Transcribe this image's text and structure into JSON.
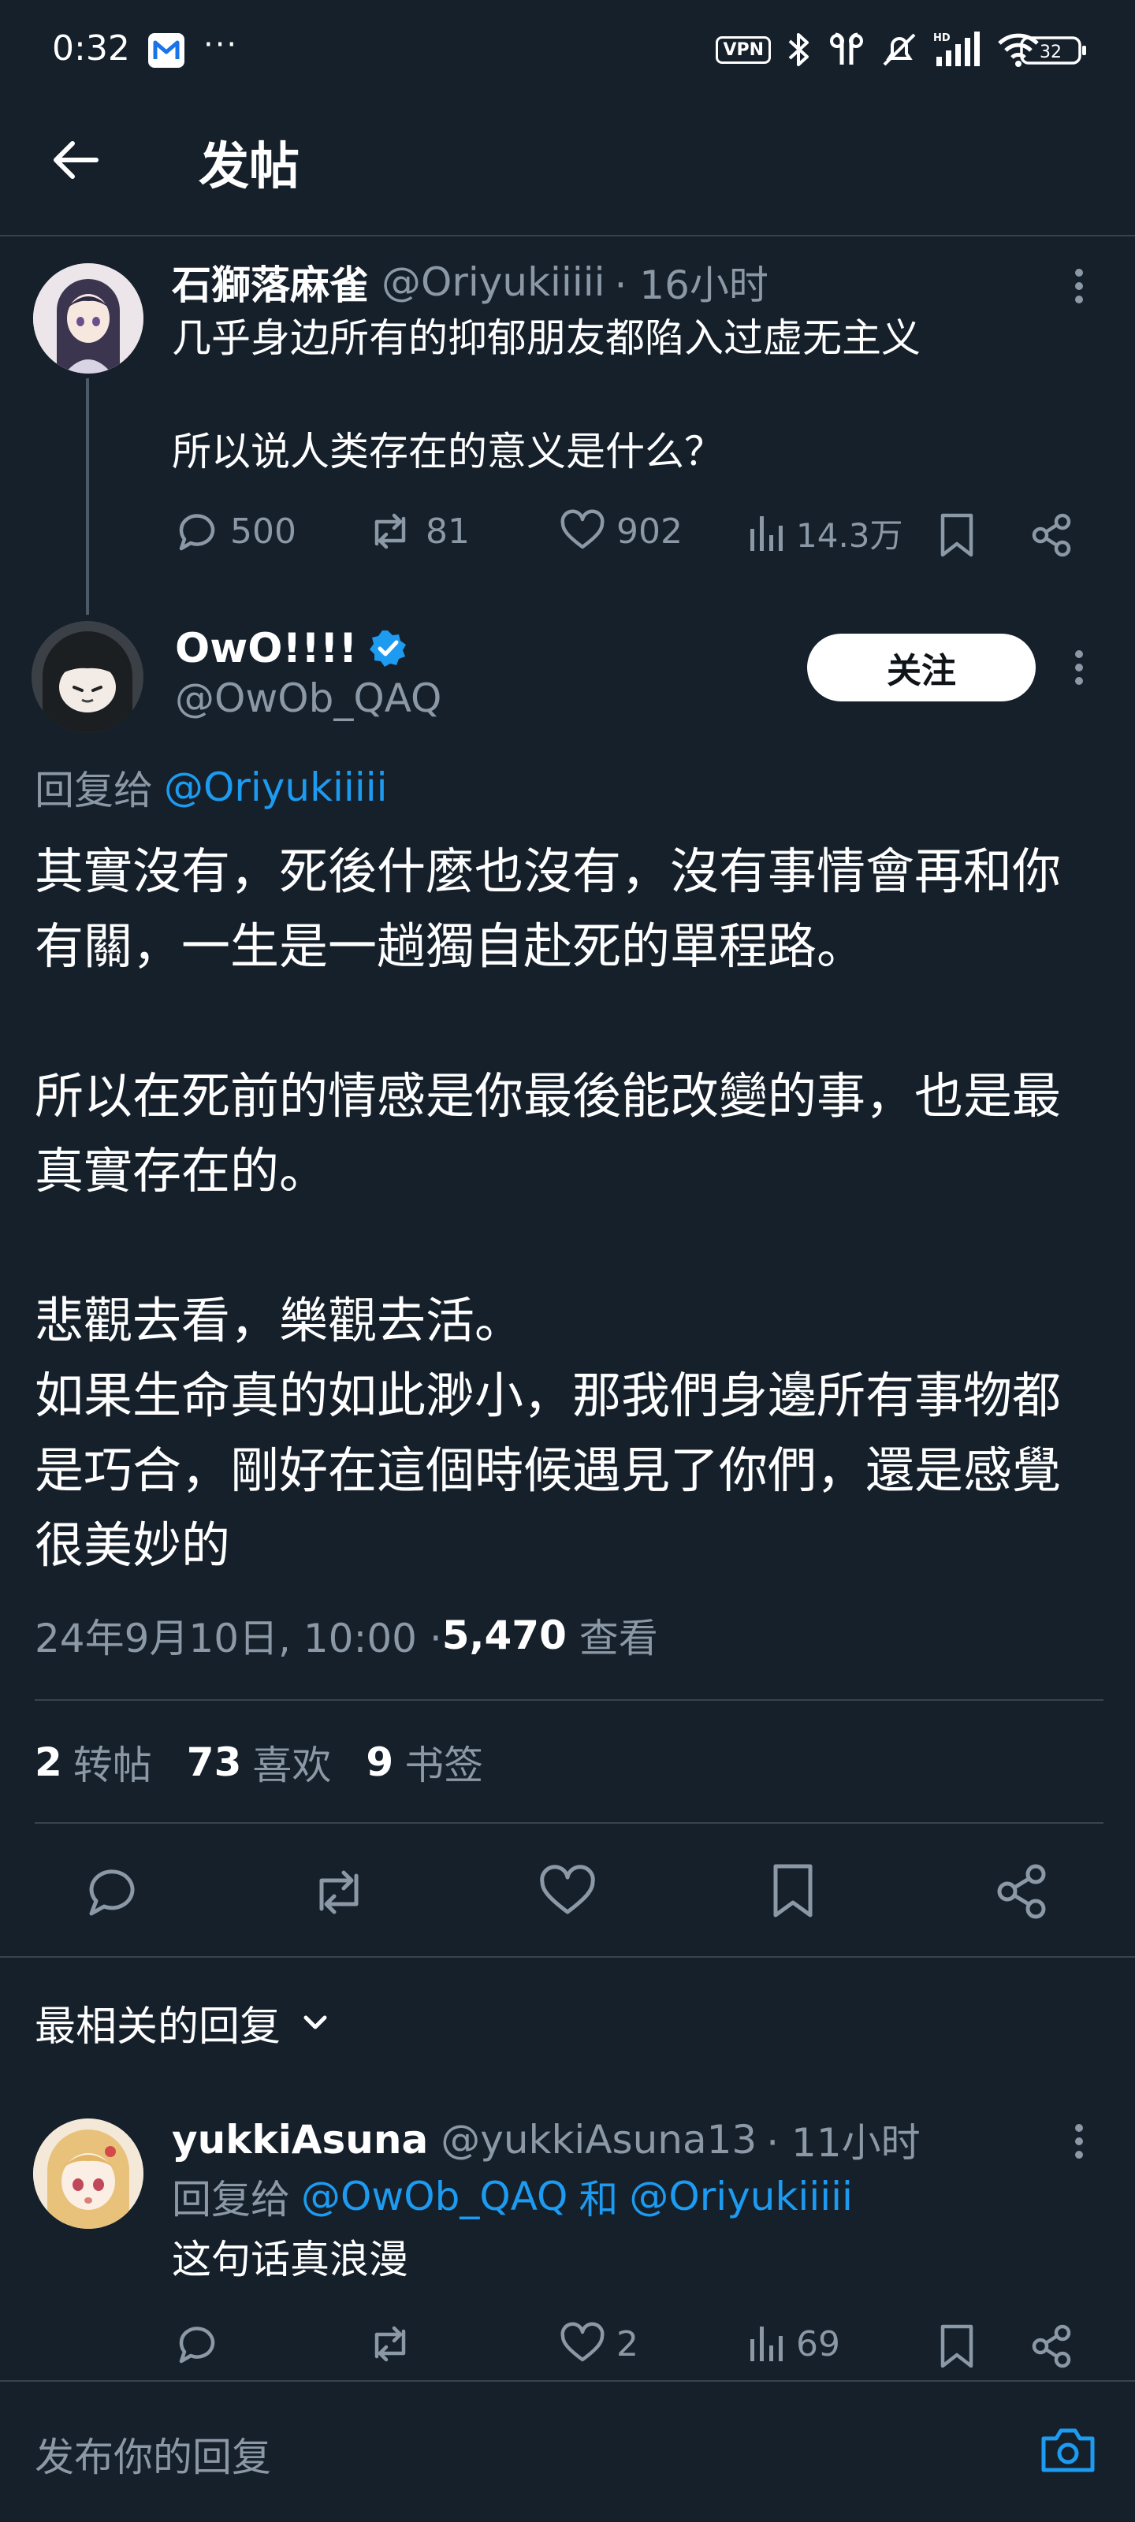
{
  "status_bar": {
    "time": "0:32",
    "dots": "···",
    "vpn": "VPN",
    "battery": "32"
  },
  "header": {
    "title": "发帖"
  },
  "parent_post": {
    "author_name": "石獅落麻雀",
    "handle": "@Oriyukiiiii",
    "time": "· 16小时",
    "line1": "几乎身边所有的抑郁朋友都陷入过虚无主义",
    "line2": "所以说人类存在的意义是什么？",
    "replies": "500",
    "reposts": "81",
    "likes": "902",
    "views": "14.3万"
  },
  "main_post": {
    "author_name": "OwO!!!!",
    "handle": "@OwOb_QAQ",
    "follow_label": "关注",
    "reply_prefix": "回复给",
    "reply_to": "@Oriyukiiiii",
    "body": "其實沒有，死後什麼也沒有，沒有事情會再和你有關，一生是一趟獨自赴死的單程路。\n\n所以在死前的情感是你最後能改變的事，也是最真實存在的。\n\n悲觀去看，樂觀去活。\n如果生命真的如此渺小，那我們身邊所有事物都是巧合，剛好在這個時候遇見了你們，還是感覺很美妙的",
    "datetime": "24年9月10日, 10:00 · ",
    "views_count": "5,470",
    "views_label": " 查看",
    "reposts_count": "2",
    "reposts_label": "转帖",
    "likes_count": "73",
    "likes_label": "喜欢",
    "bookmarks_count": "9",
    "bookmarks_label": "书签"
  },
  "replies_section": {
    "sort_label": "最相关的回复"
  },
  "reply": {
    "author_name": "yukkiAsuna",
    "handle": "@yukkiAsuna13",
    "time": "· 11小时",
    "reply_prefix": "回复给",
    "reply_to_1": "@OwOb_QAQ",
    "reply_and": "和",
    "reply_to_2": "@Oriyukiiiii",
    "text": "这句话真浪漫",
    "likes": "2",
    "views": "69"
  },
  "composer": {
    "placeholder": "发布你的回复"
  },
  "colors": {
    "background": "#15202b",
    "accent": "#1d9bf0",
    "muted": "#8b98a5",
    "divider": "#38444d"
  }
}
